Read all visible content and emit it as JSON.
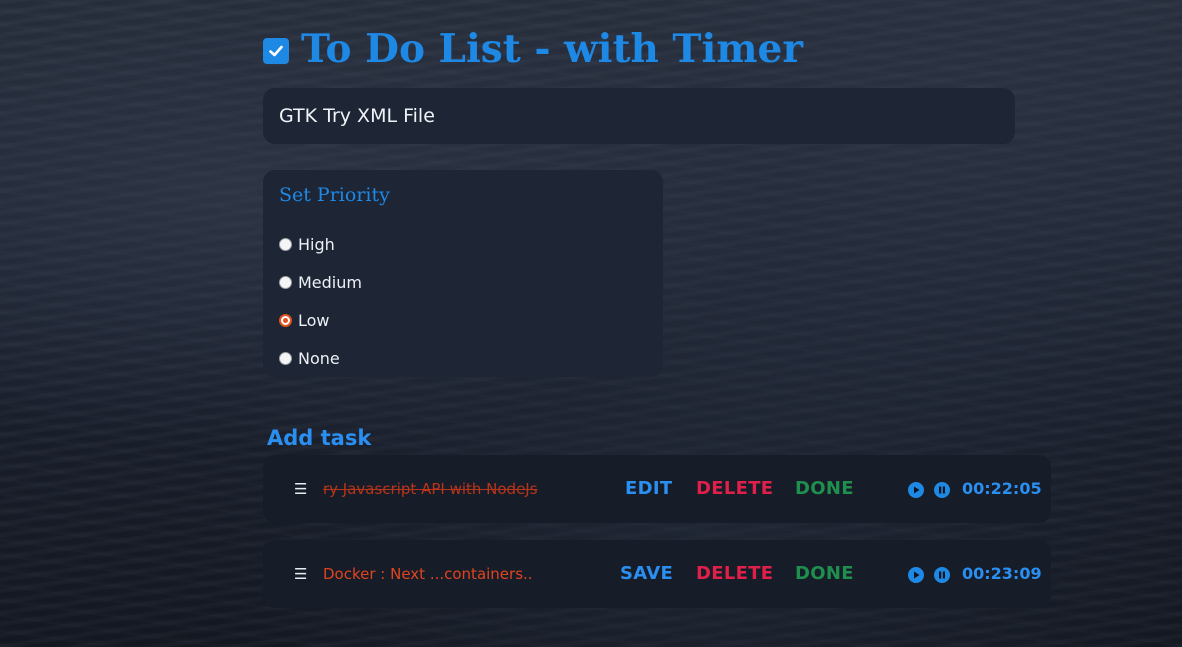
{
  "header": {
    "title": "To Do List - with Timer",
    "icon": "checkbox-checked-icon"
  },
  "task_input": {
    "value": "GTK Try XML File"
  },
  "priority": {
    "title": "Set Priority",
    "options": [
      {
        "label": "High",
        "checked": false
      },
      {
        "label": "Medium",
        "checked": false
      },
      {
        "label": "Low",
        "checked": true
      },
      {
        "label": "None",
        "checked": false
      }
    ]
  },
  "add_task_label": "Add task",
  "tasks": [
    {
      "handle": "☰",
      "text": "ry Javascript API with NodeJs",
      "completed": true,
      "edit_label": "EDIT",
      "delete_label": "DELETE",
      "done_label": "DONE",
      "timer": "00:22:05"
    },
    {
      "handle": "☰",
      "text": "Docker : Next ...containers..",
      "completed": false,
      "edit_label": "SAVE",
      "delete_label": "DELETE",
      "done_label": "DONE",
      "timer": "00:23:09"
    }
  ],
  "colors": {
    "accent": "#1e88e5",
    "delete": "#e01f4a",
    "done": "#1f8f4e",
    "task_text": "#e0441f"
  }
}
